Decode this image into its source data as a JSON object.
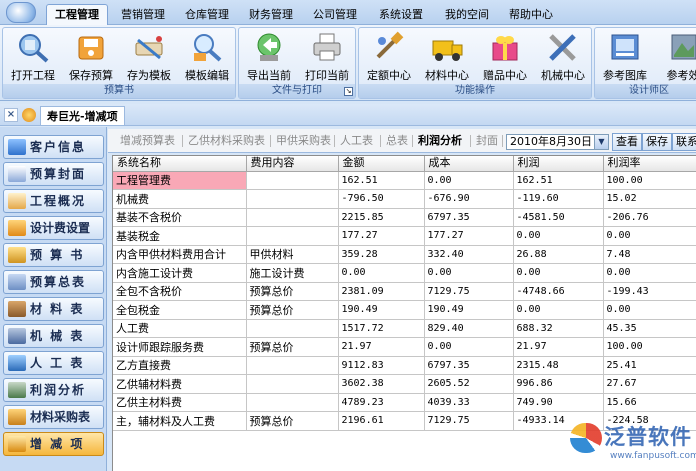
{
  "menu": {
    "items": [
      "工程管理",
      "营销管理",
      "仓库管理",
      "财务管理",
      "公司管理",
      "系统设置",
      "我的空间",
      "帮助中心"
    ],
    "active_index": 0
  },
  "ribbon": {
    "groups": [
      {
        "label": "预算书",
        "buttons": [
          {
            "label": "打开工程",
            "icon": "open-project-icon"
          },
          {
            "label": "保存预算",
            "icon": "save-budget-icon"
          },
          {
            "label": "存为模板",
            "icon": "save-template-icon"
          },
          {
            "label": "模板编辑",
            "icon": "edit-template-icon"
          }
        ]
      },
      {
        "label": "文件与打印",
        "buttons": [
          {
            "label": "导出当前",
            "icon": "export-icon"
          },
          {
            "label": "打印当前",
            "icon": "printer-icon"
          }
        ]
      },
      {
        "label": "功能操作",
        "buttons": [
          {
            "label": "定额中心",
            "icon": "quota-center-icon"
          },
          {
            "label": "材料中心",
            "icon": "material-center-icon"
          },
          {
            "label": "赠品中心",
            "icon": "gift-center-icon"
          },
          {
            "label": "机械中心",
            "icon": "machine-center-icon"
          }
        ]
      },
      {
        "label": "设计师区",
        "buttons": [
          {
            "label": "参考图库",
            "icon": "reference-gallery-icon"
          },
          {
            "label": "参考效",
            "icon": "reference-effect-icon"
          }
        ]
      }
    ]
  },
  "project": {
    "title": "寿巨光-增减项",
    "close": "×"
  },
  "nav": {
    "items": [
      "客户信息",
      "预算封面",
      "工程概况",
      "设计费设置",
      "预 算 书",
      "预算总表",
      "材 料 表",
      "机 械 表",
      "人 工 表",
      "利润分析",
      "材料采购表",
      "增 减 项"
    ],
    "active_index": 11
  },
  "tabs": {
    "items": [
      "增减预算表",
      "乙供材料采购表",
      "甲供采购表",
      "人工表",
      "总表",
      "利润分析",
      "封面"
    ],
    "active_index": 5,
    "date": "2010年8月30日",
    "buttons": [
      "查看",
      "保存",
      "联系"
    ]
  },
  "table": {
    "columns": [
      "系统名称",
      "费用内容",
      "金额",
      "成本",
      "利润",
      "利润率"
    ],
    "rows": [
      [
        "工程管理费",
        "",
        "162.51",
        "0.00",
        "162.51",
        "100.00"
      ],
      [
        "机械费",
        "",
        "-796.50",
        "-676.90",
        "-119.60",
        "15.02"
      ],
      [
        "基装不含税价",
        "",
        "2215.85",
        "6797.35",
        "-4581.50",
        "-206.76"
      ],
      [
        "基装税金",
        "",
        "177.27",
        "177.27",
        "0.00",
        "0.00"
      ],
      [
        "内含甲供材料费用合计",
        "甲供材料",
        "359.28",
        "332.40",
        "26.88",
        "7.48"
      ],
      [
        "内含施工设计费",
        "施工设计费",
        "0.00",
        "0.00",
        "0.00",
        "0.00"
      ],
      [
        "全包不含税价",
        "预算总价",
        "2381.09",
        "7129.75",
        "-4748.66",
        "-199.43"
      ],
      [
        "全包税金",
        "预算总价",
        "190.49",
        "190.49",
        "0.00",
        "0.00"
      ],
      [
        "人工费",
        "",
        "1517.72",
        "829.40",
        "688.32",
        "45.35"
      ],
      [
        "设计师跟踪服务费",
        "预算总价",
        "21.97",
        "0.00",
        "21.97",
        "100.00"
      ],
      [
        "乙方直接费",
        "",
        "9112.83",
        "6797.35",
        "2315.48",
        "25.41"
      ],
      [
        "乙供辅材料费",
        "",
        "3602.38",
        "2605.52",
        "996.86",
        "27.67"
      ],
      [
        "乙供主材料费",
        "",
        "4789.23",
        "4039.33",
        "749.90",
        "15.66"
      ],
      [
        "主，辅材料及人工费",
        "预算总价",
        "2196.61",
        "7129.75",
        "-4933.14",
        "-224.58"
      ]
    ],
    "highlight_row": 0
  },
  "watermark": {
    "brand": "泛普软件",
    "url": "www.fanpusoft.com"
  }
}
